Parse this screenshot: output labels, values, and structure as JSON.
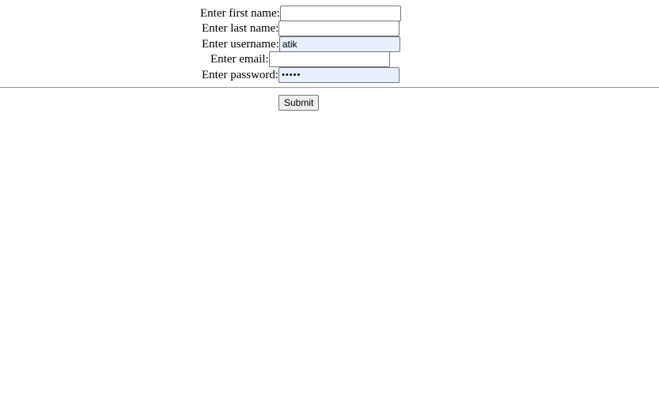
{
  "form": {
    "first_name": {
      "label": "Enter first name:",
      "value": "",
      "type": "text"
    },
    "last_name": {
      "label": "Enter last name:",
      "value": "",
      "type": "text"
    },
    "username": {
      "label": "Enter username:",
      "value": "atik",
      "type": "text"
    },
    "email": {
      "label": "Enter email:",
      "value": "",
      "type": "text"
    },
    "password": {
      "label": "Enter password:",
      "value": "•••••",
      "type": "password"
    },
    "submit_label": "Submit"
  },
  "colors": {
    "autofill_background": "#e8f0fe",
    "input_border": "#767676",
    "divider": "#9a9a9a",
    "button_background": "#efefef"
  }
}
